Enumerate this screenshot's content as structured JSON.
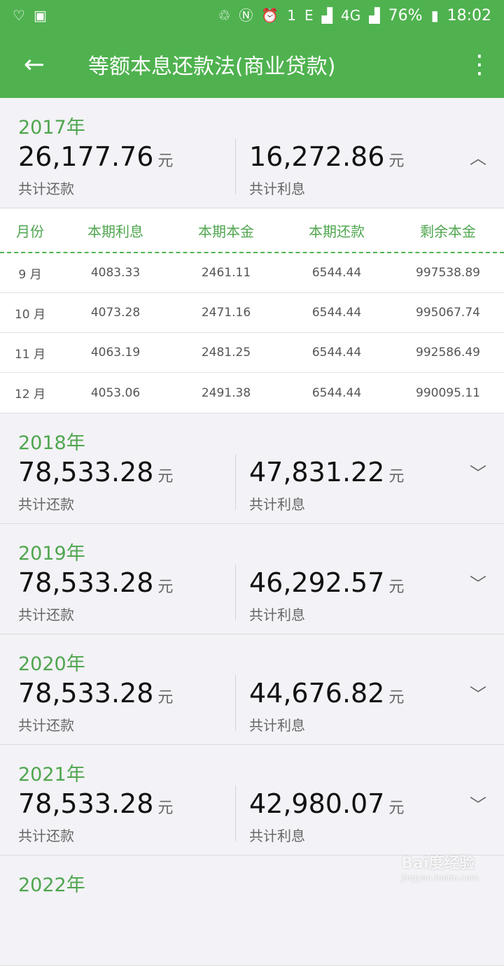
{
  "status": {
    "battery": "76%",
    "time": "18:02",
    "network": "4G",
    "signal_label": "E",
    "notif_count": "1"
  },
  "appbar": {
    "title": "等额本息还款法(商业贷款)",
    "back_icon": "arrow-left-icon",
    "more_icon": "more-vert-icon"
  },
  "years": [
    {
      "year": "2017年",
      "total": "26,177.76",
      "interest": "16,272.86",
      "unit": "元",
      "total_caption": "共计还款",
      "interest_caption": "共计利息",
      "expanded": true
    },
    {
      "year": "2018年",
      "total": "78,533.28",
      "interest": "47,831.22",
      "unit": "元",
      "total_caption": "共计还款",
      "interest_caption": "共计利息"
    },
    {
      "year": "2019年",
      "total": "78,533.28",
      "interest": "46,292.57",
      "unit": "元",
      "total_caption": "共计还款",
      "interest_caption": "共计利息"
    },
    {
      "year": "2020年",
      "total": "78,533.28",
      "interest": "44,676.82",
      "unit": "元",
      "total_caption": "共计还款",
      "interest_caption": "共计利息"
    },
    {
      "year": "2021年",
      "total": "78,533.28",
      "interest": "42,980.07",
      "unit": "元",
      "total_caption": "共计还款",
      "interest_caption": "共计利息"
    },
    {
      "year": "2022年"
    }
  ],
  "table": {
    "headers": [
      "月份",
      "本期利息",
      "本期本金",
      "本期还款",
      "剩余本金"
    ],
    "rows": [
      [
        "9 月",
        "4083.33",
        "2461.11",
        "6544.44",
        "997538.89"
      ],
      [
        "10 月",
        "4073.28",
        "2471.16",
        "6544.44",
        "995067.74"
      ],
      [
        "11 月",
        "4063.19",
        "2481.25",
        "6544.44",
        "992586.49"
      ],
      [
        "12 月",
        "4053.06",
        "2491.38",
        "6544.44",
        "990095.11"
      ]
    ]
  },
  "watermark": {
    "text": "Bai度经验",
    "sub": "jingyan.baidu.com"
  },
  "colors": {
    "primary": "#4fb24f",
    "year_text": "#4fa64f",
    "background": "#f3f2f6"
  }
}
